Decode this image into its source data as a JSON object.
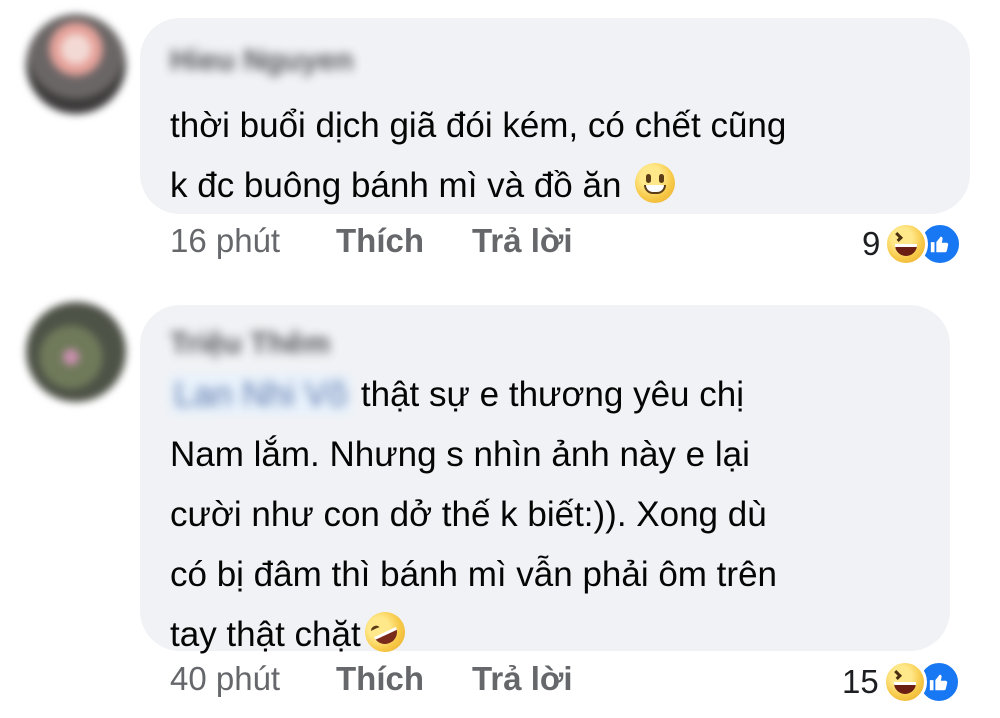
{
  "comments": [
    {
      "author": "Hieu Nguyen",
      "text_lines": [
        "thời buổi dịch giã đói kém, có chết cũng",
        "k đc buông bánh mì và đồ ăn"
      ],
      "emoji": "grinning-face-emoji",
      "time": "16 phút",
      "like_label": "Thích",
      "reply_label": "Trả lời",
      "reaction_count": "9",
      "reactions": [
        "haha-reaction-icon",
        "like-reaction-icon"
      ]
    },
    {
      "author": "Triệu Thêm",
      "mention": "Lan Nhi Võ",
      "text_lines": [
        "thật sự e thương yêu chị",
        "Nam lắm. Nhưng s nhìn ảnh này e lại",
        "cười như con dở thế k biết:)). Xong dù",
        "có bị đâm thì bánh mì vẫn phải ôm trên",
        "tay thật chặt"
      ],
      "emoji": "rolling-on-floor-laughing-emoji",
      "time": "40 phút",
      "like_label": "Thích",
      "reply_label": "Trả lời",
      "reaction_count": "15",
      "reactions": [
        "haha-reaction-icon",
        "like-reaction-icon"
      ]
    }
  ],
  "colors": {
    "bubble_bg": "#f0f2f5",
    "meta_text": "#65676b",
    "like_blue": "#1877f2"
  }
}
